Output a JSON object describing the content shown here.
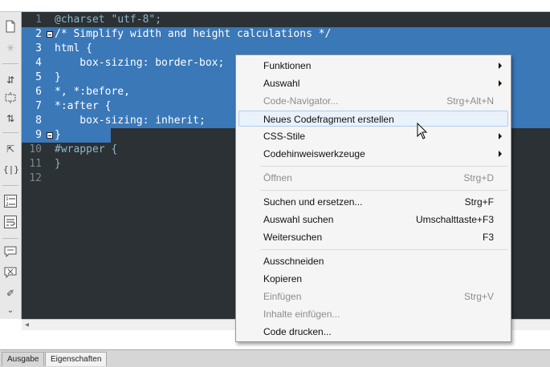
{
  "editor": {
    "lines": [
      {
        "num": "1",
        "text": "@charset \"utf-8\";",
        "selected": false
      },
      {
        "num": "2",
        "text": "/* Simplify width and height calculations */",
        "selected": true
      },
      {
        "num": "3",
        "text": "html {",
        "selected": true
      },
      {
        "num": "4",
        "text": "    box-sizing: border-box;",
        "selected": true
      },
      {
        "num": "5",
        "text": "}",
        "selected": true
      },
      {
        "num": "6",
        "text": "*, *:before,",
        "selected": true
      },
      {
        "num": "7",
        "text": "*:after {",
        "selected": true
      },
      {
        "num": "8",
        "text": "    box-sizing: inherit;",
        "selected": true
      },
      {
        "num": "9",
        "text": "}",
        "selected": true
      },
      {
        "num": "10",
        "text": "#wrapper {",
        "selected": false
      },
      {
        "num": "11",
        "text": "}",
        "selected": false
      },
      {
        "num": "12",
        "text": "",
        "selected": false
      }
    ]
  },
  "context_menu": {
    "items": [
      {
        "label": "Funktionen",
        "shortcut": "",
        "submenu": true,
        "disabled": false
      },
      {
        "label": "Auswahl",
        "shortcut": "",
        "submenu": true,
        "disabled": false
      },
      {
        "label": "Code-Navigator...",
        "shortcut": "Strg+Alt+N",
        "submenu": false,
        "disabled": true
      },
      {
        "label": "Neues Codefragment erstellen",
        "shortcut": "",
        "submenu": false,
        "disabled": false
      },
      {
        "label": "CSS-Stile",
        "shortcut": "",
        "submenu": true,
        "disabled": false
      },
      {
        "label": "Codehinweiswerkzeuge",
        "shortcut": "",
        "submenu": true,
        "disabled": false
      },
      {
        "label": "Öffnen",
        "shortcut": "Strg+D",
        "submenu": false,
        "disabled": true
      },
      {
        "label": "Suchen und ersetzen...",
        "shortcut": "Strg+F",
        "submenu": false,
        "disabled": false
      },
      {
        "label": "Auswahl suchen",
        "shortcut": "Umschalttaste+F3",
        "submenu": false,
        "disabled": false
      },
      {
        "label": "Weitersuchen",
        "shortcut": "F3",
        "submenu": false,
        "disabled": false
      },
      {
        "label": "Ausschneiden",
        "shortcut": "",
        "submenu": false,
        "disabled": false
      },
      {
        "label": "Kopieren",
        "shortcut": "",
        "submenu": false,
        "disabled": false
      },
      {
        "label": "Einfügen",
        "shortcut": "Strg+V",
        "submenu": false,
        "disabled": true
      },
      {
        "label": "Inhalte einfügen...",
        "shortcut": "",
        "submenu": false,
        "disabled": true
      },
      {
        "label": "Code drucken...",
        "shortcut": "",
        "submenu": false,
        "disabled": false
      }
    ],
    "hovered_item": "Neues Codefragment erstellen"
  },
  "bottom_panel": {
    "tabs": [
      {
        "label": "Ausgabe",
        "active": false
      },
      {
        "label": "Eigenschaften",
        "active": true
      }
    ]
  },
  "toolbar": {
    "icons": [
      "open-documents-icon",
      "highlight-icon",
      "collapse-full-tag-icon",
      "collapse-selection-icon",
      "expand-all-icon",
      "select-parent-tag-icon",
      "balance-braces-icon",
      "line-numbers-icon",
      "word-wrap-icon",
      "apply-comment-icon",
      "remove-comment-icon",
      "format-source-icon",
      "more-icon"
    ]
  },
  "colors": {
    "editor_bg": "#2b3134",
    "selection": "#3a78b8",
    "menu_bg": "#f5f5f5",
    "menu_hover": "#e9f1fb"
  }
}
